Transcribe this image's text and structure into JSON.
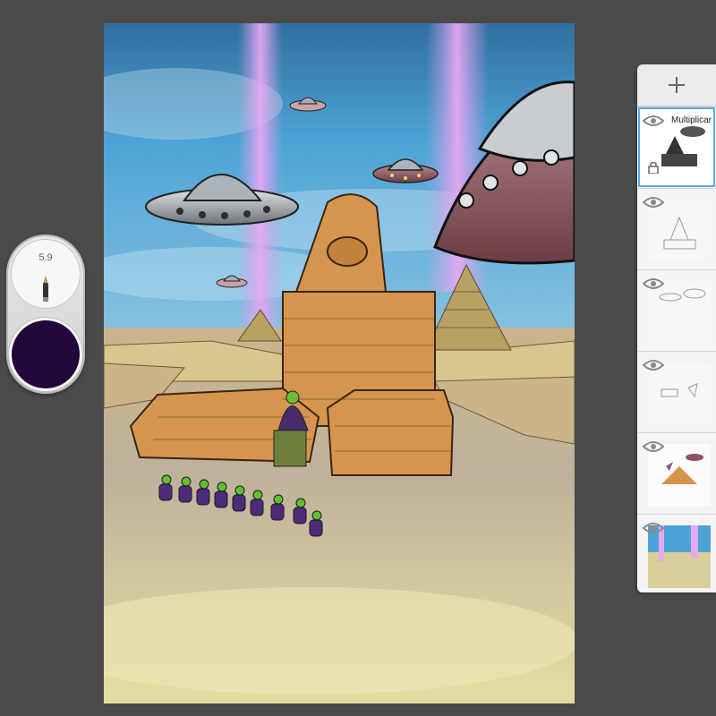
{
  "brush": {
    "size_label": "5.9",
    "color": "#23073a"
  },
  "layers_panel": {
    "add_icon": "plus-icon",
    "layers": [
      {
        "name": "Multiplicar",
        "visible": true,
        "active": true,
        "locked": true
      },
      {
        "name": "",
        "visible": true,
        "active": false,
        "locked": false
      },
      {
        "name": "",
        "visible": true,
        "active": false,
        "locked": false
      },
      {
        "name": "",
        "visible": true,
        "active": false,
        "locked": false
      },
      {
        "name": "",
        "visible": true,
        "active": false,
        "locked": false
      },
      {
        "name": "",
        "visible": true,
        "active": false,
        "locked": false
      }
    ]
  },
  "colors": {
    "app_background": "#4a4a4a",
    "sky": "#3f8fc6",
    "sphinx": "#d6954f",
    "beam": "#d59be6"
  }
}
